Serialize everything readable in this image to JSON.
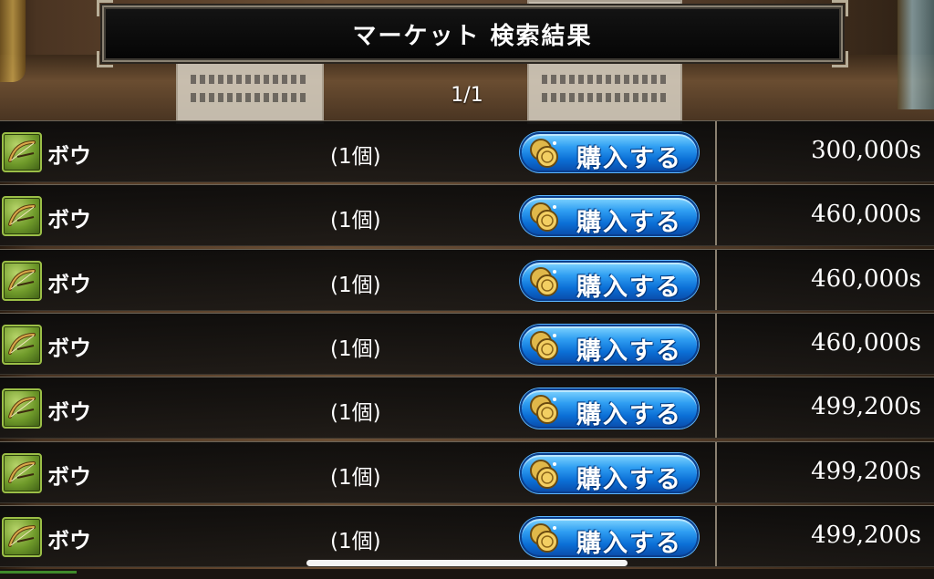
{
  "header": {
    "title": "マーケット 検索結果",
    "page_indicator": "1/1"
  },
  "listings": [
    {
      "name": "ボウ",
      "quantity": "(1個)",
      "buy_label": "購入する",
      "price": "300,000s",
      "icon": "bow-icon"
    },
    {
      "name": "ボウ",
      "quantity": "(1個)",
      "buy_label": "購入する",
      "price": "460,000s",
      "icon": "bow-icon"
    },
    {
      "name": "ボウ",
      "quantity": "(1個)",
      "buy_label": "購入する",
      "price": "460,000s",
      "icon": "bow-icon"
    },
    {
      "name": "ボウ",
      "quantity": "(1個)",
      "buy_label": "購入する",
      "price": "460,000s",
      "icon": "bow-icon"
    },
    {
      "name": "ボウ",
      "quantity": "(1個)",
      "buy_label": "購入する",
      "price": "499,200s",
      "icon": "bow-icon"
    },
    {
      "name": "ボウ",
      "quantity": "(1個)",
      "buy_label": "購入する",
      "price": "499,200s",
      "icon": "bow-icon"
    },
    {
      "name": "ボウ",
      "quantity": "(1個)",
      "buy_label": "購入する",
      "price": "499,200s",
      "icon": "bow-icon"
    }
  ],
  "colors": {
    "buy_button": "#1f86e6",
    "item_icon_bg": "#6f9a2a",
    "row_bg": "#111111"
  }
}
